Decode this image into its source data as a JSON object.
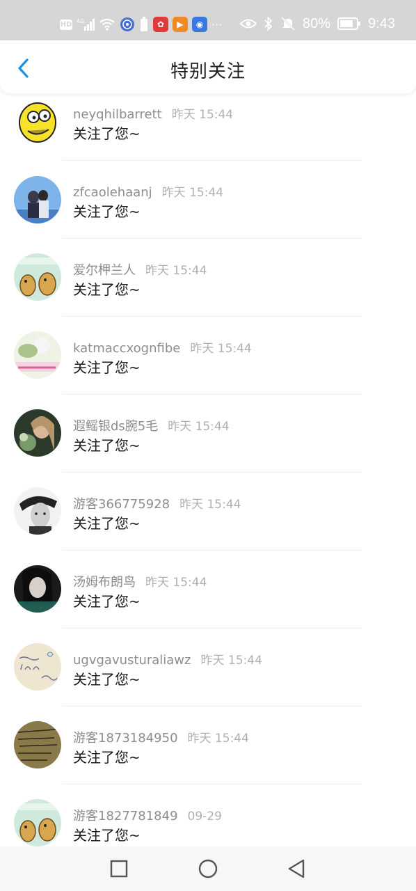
{
  "status_bar": {
    "battery_pct": "80%",
    "time": "9:43",
    "hd_label": "HD",
    "signal_label": "4G"
  },
  "header": {
    "title": "特别关注",
    "back_icon": "chevron-left-icon"
  },
  "list": [
    {
      "name": "neyqhilbarrett",
      "time": "昨天 15:44",
      "message": "关注了您~",
      "avatar": "cartoon-yellow"
    },
    {
      "name": "zfcaolehaanj",
      "time": "昨天 15:44",
      "message": "关注了您~",
      "avatar": "couple-sky"
    },
    {
      "name": "爱尔柙兰人",
      "time": "昨天 15:44",
      "message": "关注了您~",
      "avatar": "cartoon-dogs"
    },
    {
      "name": "katmaccxognfibe",
      "time": "昨天 15:44",
      "message": "关注了您~",
      "avatar": "flower-text"
    },
    {
      "name": "遐鳐银ds腕5毛",
      "time": "昨天 15:44",
      "message": "关注了您~",
      "avatar": "girl-flowers"
    },
    {
      "name": "游客366775928",
      "time": "昨天 15:44",
      "message": "关注了您~",
      "avatar": "man-bw"
    },
    {
      "name": "汤姆布朗鸟",
      "time": "昨天 15:44",
      "message": "关注了您~",
      "avatar": "woman-dark"
    },
    {
      "name": "ugvgavusturaliawz",
      "time": "昨天 15:44",
      "message": "关注了您~",
      "avatar": "handwriting-love"
    },
    {
      "name": "游客1873184950",
      "time": "昨天 15:44",
      "message": "关注了您~",
      "avatar": "handwriting-dark"
    },
    {
      "name": "游客1827781849",
      "time": "09-29",
      "message": "关注了您~",
      "avatar": "cartoon-dogs"
    }
  ],
  "nav_bar": {
    "recent_icon": "square-icon",
    "home_icon": "circle-icon",
    "back_icon": "triangle-back-icon"
  },
  "colors": {
    "accent": "#1e8fe6",
    "status_bar_bg": "#d6d6d6",
    "name_text": "#8d8d8d",
    "time_text": "#b0b0b0"
  }
}
